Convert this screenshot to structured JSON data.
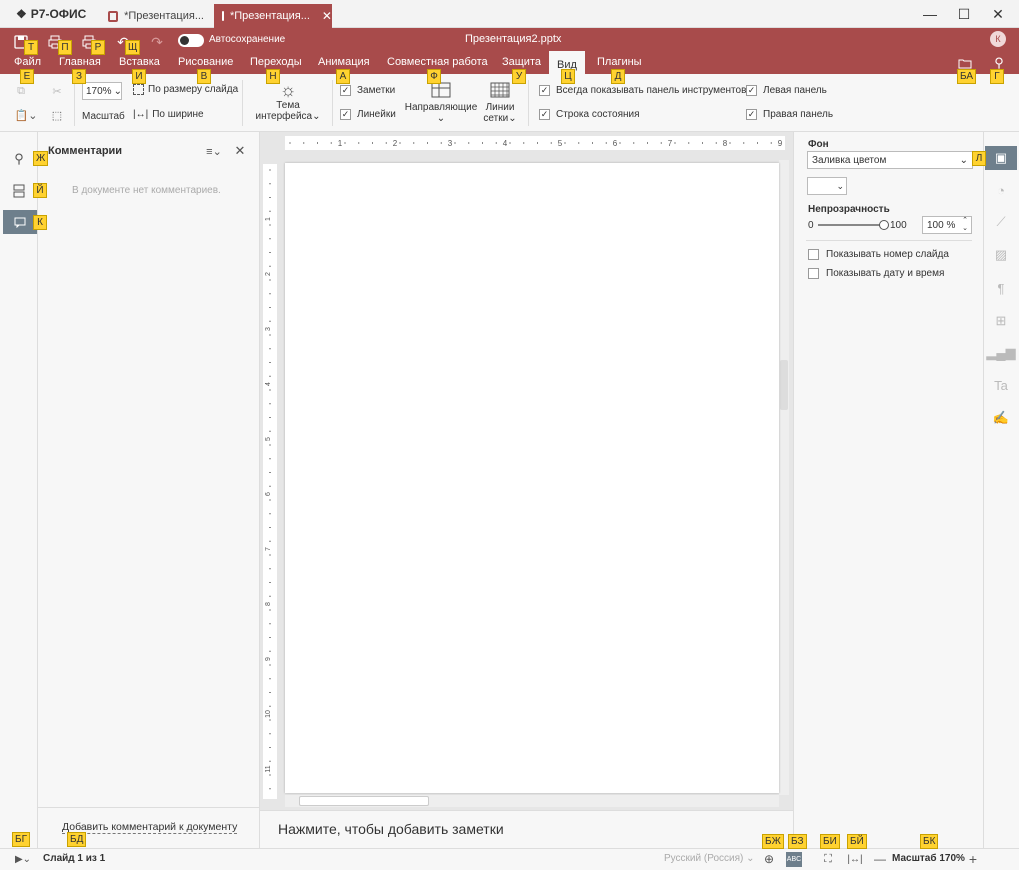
{
  "app": {
    "logo": "Р7-ОФИС"
  },
  "tabs": [
    {
      "label": "*Презентация..."
    },
    {
      "label": "*Презентация..."
    }
  ],
  "header": {
    "doc_title": "Презентация2.pptx",
    "autosave_label": "Автосохранение",
    "avatar_initial": "К"
  },
  "menu": [
    "Файл",
    "Главная",
    "Вставка",
    "Рисование",
    "Переходы",
    "Анимация",
    "Совместная работа",
    "Защита",
    "Вид",
    "Плагины"
  ],
  "toolbar": {
    "zoom_value": "170%",
    "zoom_label": "Масштаб",
    "fit_slide": "По размеру слайда",
    "fit_width": "По ширине",
    "theme_label_1": "Тема",
    "theme_label_2": "интерфейса",
    "notes": "Заметки",
    "rulers": "Линейки",
    "guides": "Направляющие",
    "gridlines_1": "Линии",
    "gridlines_2": "сетки",
    "always_show_toolbar": "Всегда показывать панель инструментов",
    "status_bar": "Строка состояния",
    "left_panel": "Левая панель",
    "right_panel": "Правая панель"
  },
  "comments": {
    "title": "Комментарии",
    "empty": "В документе нет комментариев.",
    "add": "Добавить комментарий к документу"
  },
  "notes_placeholder": "Нажмите, чтобы добавить заметки",
  "ruler_h": [
    "1",
    "2",
    "3",
    "4",
    "5",
    "6",
    "7",
    "8",
    "9"
  ],
  "ruler_v": [
    "1",
    "2",
    "3",
    "4",
    "5",
    "6",
    "7",
    "8",
    "9",
    "10",
    "11"
  ],
  "right_panel": {
    "bg_label": "Фон",
    "fill_value": "Заливка цветом",
    "opacity_label": "Непрозрачность",
    "opacity_min": "0",
    "opacity_max": "100",
    "opacity_value": "100 %",
    "opacity_level": 1.0,
    "show_slide_number": "Показывать номер слайда",
    "show_date": "Показывать дату и время"
  },
  "status": {
    "slide": "Слайд 1 из 1",
    "language": "Русский (Россия)",
    "zoom": "Масштаб 170%"
  },
  "hotkeys": {
    "t": "Т",
    "p": "П",
    "r": "Р",
    "sh": "Щ",
    "e": "Е",
    "z": "З",
    "i": "И",
    "v": "В",
    "n": "Н",
    "a": "А",
    "f": "Ф",
    "u": "У",
    "ts": "Ц",
    "d": "Д",
    "ba": "БА",
    "g": "Г",
    "zh": "Ж",
    "y": "Й",
    "k": "К",
    "l": "Л",
    "bg": "БГ",
    "bd": "БД",
    "bzh": "БЖ",
    "bz": "БЗ",
    "bi": "БИ",
    "by": "БЙ",
    "bk": "БК"
  },
  "colors": {
    "accent": "#a84b4b",
    "badge": "#ffd230"
  }
}
